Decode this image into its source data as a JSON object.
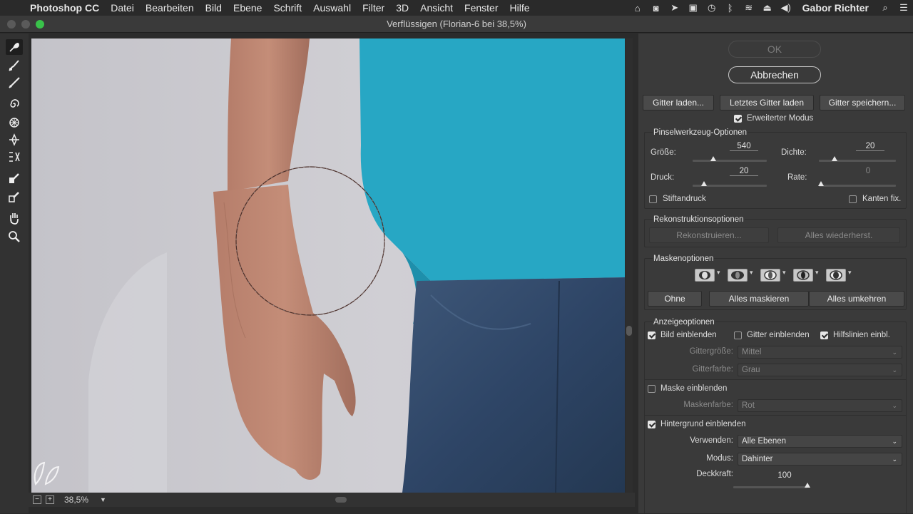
{
  "menubar": {
    "app_name": "Photoshop CC",
    "items": [
      "Datei",
      "Bearbeiten",
      "Bild",
      "Ebene",
      "Schrift",
      "Auswahl",
      "Filter",
      "3D",
      "Ansicht",
      "Fenster",
      "Hilfe"
    ],
    "user": "Gabor Richter",
    "status_icons": [
      "home-icon",
      "camera-icon",
      "send-icon",
      "battery-display-icon",
      "time-machine-icon",
      "bluetooth-icon",
      "wifi-icon",
      "eject-icon",
      "volume-icon"
    ]
  },
  "window": {
    "title": "Verflüssigen (Florian-6 bei 38,5%)"
  },
  "tools": [
    "forward-warp-tool-icon",
    "reconstruct-tool-icon",
    "smooth-tool-icon",
    "twirl-tool-icon",
    "pucker-tool-icon",
    "bloat-tool-icon",
    "push-left-tool-icon",
    "freeze-mask-tool-icon",
    "thaw-mask-tool-icon",
    "hand-tool-icon",
    "zoom-tool-icon"
  ],
  "statusbar": {
    "zoom_out": "−",
    "zoom_in": "+",
    "zoom": "38,5%"
  },
  "panel": {
    "ok": "OK",
    "cancel": "Abbrechen",
    "load_mesh": "Gitter laden...",
    "load_last_mesh": "Letztes Gitter laden",
    "save_mesh": "Gitter speichern...",
    "advanced_mode": "Erweiterter Modus",
    "brush": {
      "title": "Pinselwerkzeug-Optionen",
      "size_label": "Größe:",
      "size": "540",
      "density_label": "Dichte:",
      "density": "20",
      "pressure_label": "Druck:",
      "pressure": "20",
      "rate_label": "Rate:",
      "rate": "0",
      "stylus_label": "Stiftandruck",
      "pin_edges_label": "Kanten fix."
    },
    "reconstruct": {
      "title": "Rekonstruktionsoptionen",
      "reconstruct_btn": "Rekonstruieren...",
      "restore_all_btn": "Alles wiederherst."
    },
    "mask": {
      "title": "Maskenoptionen",
      "none_btn": "Ohne",
      "mask_all_btn": "Alles maskieren",
      "invert_all_btn": "Alles umkehren"
    },
    "view": {
      "title": "Anzeigeoptionen",
      "show_image": "Bild einblenden",
      "show_mesh": "Gitter einblenden",
      "show_guides": "Hilfslinien einbl.",
      "mesh_size_label": "Gittergröße:",
      "mesh_size": "Mittel",
      "mesh_color_label": "Gitterfarbe:",
      "mesh_color": "Grau",
      "show_mask": "Maske einblenden",
      "mask_color_label": "Maskenfarbe:",
      "mask_color": "Rot",
      "show_backdrop": "Hintergrund einblenden",
      "use_label": "Verwenden:",
      "use": "Alle Ebenen",
      "mode_label": "Modus:",
      "mode": "Dahinter",
      "opacity_label": "Deckkraft:",
      "opacity": "100"
    }
  }
}
